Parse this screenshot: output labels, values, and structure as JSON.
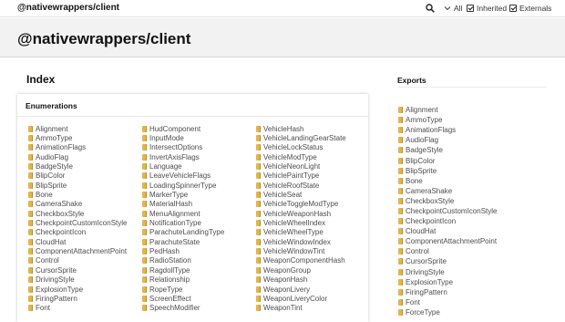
{
  "topbar": {
    "title": "@nativewrappers/client",
    "all_label": "All",
    "inherited_label": "Inherited",
    "externals_label": "Externals"
  },
  "header": {
    "title": "@nativewrappers/client"
  },
  "index": {
    "title": "Index",
    "section_title": "Enumerations",
    "columns": [
      [
        "Alignment",
        "AmmoType",
        "AnimationFlags",
        "AudioFlag",
        "BadgeStyle",
        "BlipColor",
        "BlipSprite",
        "Bone",
        "CameraShake",
        "CheckboxStyle",
        "CheckpointCustomIconStyle",
        "CheckpointIcon",
        "CloudHat",
        "ComponentAttachmentPoint",
        "Control",
        "CursorSprite",
        "DrivingStyle",
        "ExplosionType",
        "FiringPattern",
        "Font"
      ],
      [
        "HudComponent",
        "InputMode",
        "IntersectOptions",
        "InvertAxisFlags",
        "Language",
        "LeaveVehicleFlags",
        "LoadingSpinnerType",
        "MarkerType",
        "MaterialHash",
        "MenuAlignment",
        "NotificationType",
        "ParachuteLandingType",
        "ParachuteState",
        "PedHash",
        "RadioStation",
        "RagdollType",
        "Relationship",
        "RopeType",
        "ScreenEffect",
        "SpeechModifier"
      ],
      [
        "VehicleHash",
        "VehicleLandingGearState",
        "VehicleLockStatus",
        "VehicleModType",
        "VehicleNeonLight",
        "VehiclePaintType",
        "VehicleRoofState",
        "VehicleSeat",
        "VehicleToggleModType",
        "VehicleWeaponHash",
        "VehicleWheelIndex",
        "VehicleWheelType",
        "VehicleWindowIndex",
        "VehicleWindowTint",
        "WeaponComponentHash",
        "WeaponGroup",
        "WeaponHash",
        "WeaponLivery",
        "WeaponLiveryColor",
        "WeaponTint"
      ]
    ]
  },
  "exports": {
    "title": "Exports",
    "items": [
      "Alignment",
      "AmmoType",
      "AnimationFlags",
      "AudioFlag",
      "BadgeStyle",
      "BlipColor",
      "BlipSprite",
      "Bone",
      "CameraShake",
      "CheckboxStyle",
      "CheckpointCustomIconStyle",
      "CheckpointIcon",
      "CloudHat",
      "ComponentAttachmentPoint",
      "Control",
      "CursorSprite",
      "DrivingStyle",
      "ExplosionType",
      "FiringPattern",
      "Font",
      "ForceType"
    ]
  }
}
